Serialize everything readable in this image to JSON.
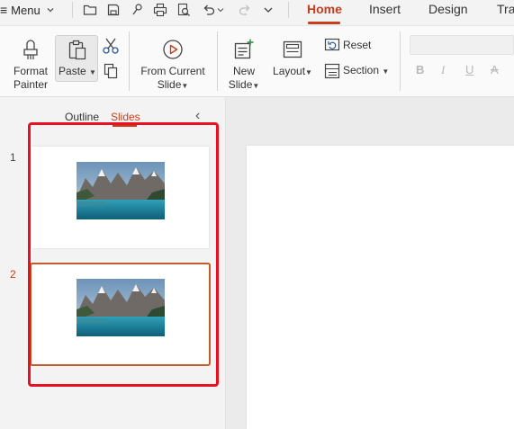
{
  "topbar": {
    "menu_label": "Menu",
    "tabs": [
      {
        "label": "Home",
        "active": true
      },
      {
        "label": "Insert",
        "active": false
      },
      {
        "label": "Design",
        "active": false
      },
      {
        "label": "Tra",
        "active": false
      }
    ],
    "quick_icons": [
      "folder-icon",
      "save-icon",
      "share-link-icon",
      "print-icon",
      "print-preview-icon",
      "undo-icon",
      "redo-icon",
      "more-chevron-icon"
    ]
  },
  "ribbon": {
    "format_painter": {
      "line1": "Format",
      "line2": "Painter"
    },
    "paste": {
      "label": "Paste"
    },
    "from_current": {
      "line1": "From Current",
      "line2": "Slide"
    },
    "new_slide": {
      "line1": "New",
      "line2": "Slide"
    },
    "layout": {
      "label": "Layout"
    },
    "reset": {
      "label": "Reset"
    },
    "section": {
      "label": "Section"
    },
    "font_format_buttons": [
      "B",
      "I",
      "U",
      "A"
    ]
  },
  "panel": {
    "tabs": [
      {
        "label": "Outline",
        "active": false
      },
      {
        "label": "Slides",
        "active": true
      }
    ],
    "collapse_glyph": "‹",
    "slides": [
      {
        "number": "1",
        "selected": false,
        "image": "mountain-lake-landscape"
      },
      {
        "number": "2",
        "selected": true,
        "image": "mountain-lake-landscape"
      }
    ]
  },
  "colors": {
    "accent": "#c43e1c",
    "highlight": "#e81123",
    "selected_border": "#c55a2b"
  }
}
